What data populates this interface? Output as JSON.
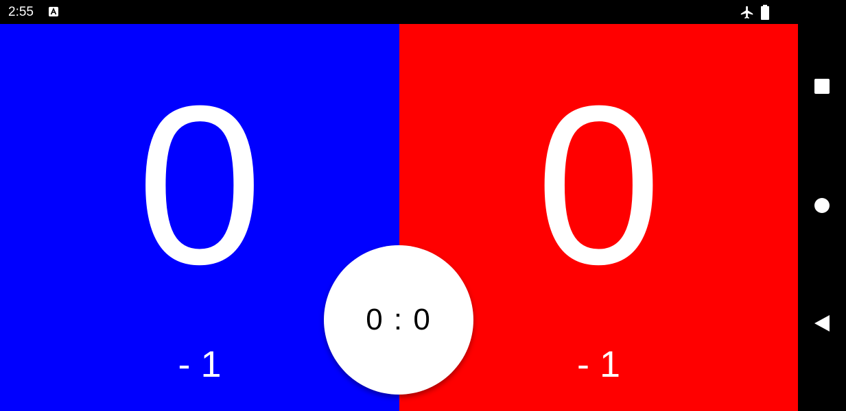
{
  "status_bar": {
    "time": "2:55",
    "icons": [
      "a-notification-icon",
      "airplane-mode-icon",
      "battery-icon"
    ]
  },
  "left_team": {
    "color": "#0000ff",
    "score": "0",
    "minus_label": "- 1"
  },
  "right_team": {
    "color": "#ff0000",
    "score": "0",
    "minus_label": "- 1"
  },
  "center": {
    "summary": "0 : 0"
  },
  "nav_bar": {
    "icons": [
      "recent-apps-icon",
      "home-icon",
      "back-icon"
    ]
  }
}
